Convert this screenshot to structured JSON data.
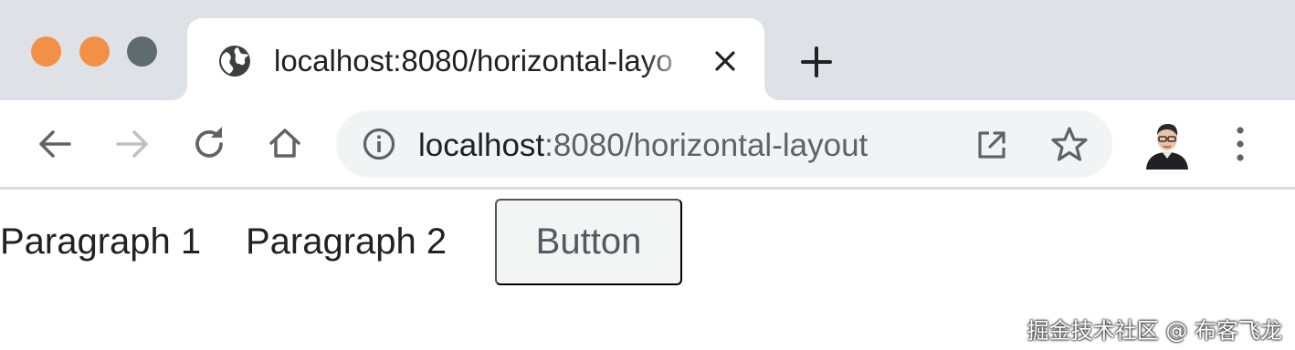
{
  "window": {
    "traffic_lights": [
      "close",
      "minimize",
      "zoom"
    ]
  },
  "tab": {
    "title": "localhost:8080/horizontal-layo",
    "favicon": "globe-icon",
    "close_icon": "close-icon"
  },
  "new_tab_icon": "plus-icon",
  "toolbar": {
    "back_icon": "back-arrow-icon",
    "forward_icon": "forward-arrow-icon",
    "reload_icon": "reload-icon",
    "home_icon": "home-icon",
    "address": {
      "host": "localhost",
      "path": ":8080/horizontal-layout",
      "info_icon": "info-icon",
      "open_icon": "open-external-icon",
      "bookmark_icon": "star-icon"
    },
    "avatar": "avatar",
    "menu_icon": "kebab-menu-icon"
  },
  "page": {
    "paragraph_1": "Paragraph 1",
    "paragraph_2": "Paragraph 2",
    "button_label": "Button"
  },
  "watermark": "掘金技术社区 @ 布客飞龙",
  "colors": {
    "tabstrip": "#dee1e6",
    "traffic_red": "#f29047",
    "traffic_yellow": "#f29047",
    "traffic_gray": "#5f6b6d",
    "omnibox": "#f1f3f4",
    "button_bg": "#f3f4f4",
    "button_text": "#505a5f"
  }
}
